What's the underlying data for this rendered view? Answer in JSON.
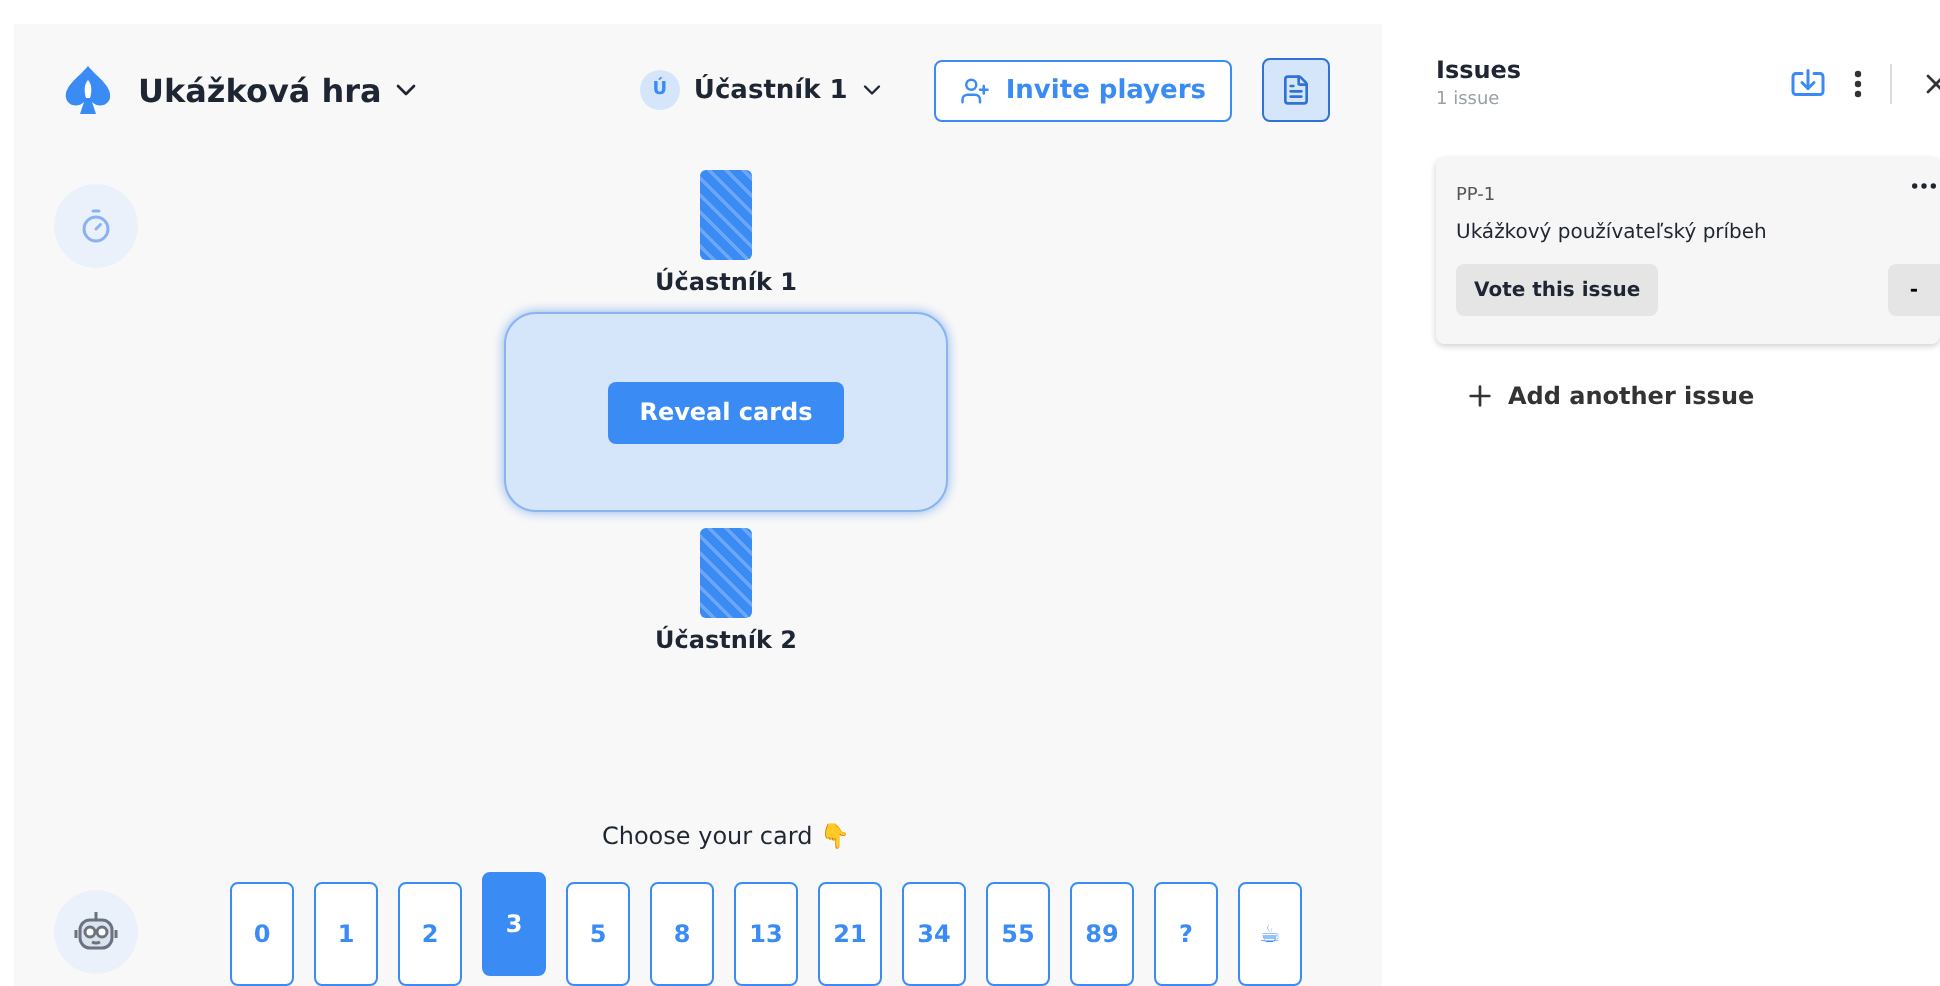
{
  "game": {
    "title": "Ukážková hra",
    "user": {
      "initial": "Ú",
      "name": "Účastník 1"
    },
    "invite_button": "Invite players"
  },
  "table": {
    "top_players": [
      {
        "name": "Účastník 1"
      }
    ],
    "reveal_button": "Reveal cards",
    "bottom_players": [
      {
        "name": "Účastník 2"
      }
    ]
  },
  "deck": {
    "prompt": "Choose your card 👇",
    "cards": [
      {
        "label": "0",
        "selected": false
      },
      {
        "label": "1",
        "selected": false
      },
      {
        "label": "2",
        "selected": false
      },
      {
        "label": "3",
        "selected": true
      },
      {
        "label": "5",
        "selected": false
      },
      {
        "label": "8",
        "selected": false
      },
      {
        "label": "13",
        "selected": false
      },
      {
        "label": "21",
        "selected": false
      },
      {
        "label": "34",
        "selected": false
      },
      {
        "label": "55",
        "selected": false
      },
      {
        "label": "89",
        "selected": false
      },
      {
        "label": "?",
        "selected": false
      },
      {
        "label": "☕",
        "selected": false
      }
    ]
  },
  "issues_panel": {
    "title": "Issues",
    "count": "1 issue",
    "issues": [
      {
        "key": "PP-1",
        "title": "Ukážkový používateľský príbeh",
        "vote_button": "Vote this issue",
        "points": "-"
      }
    ],
    "add_button": "Add another issue"
  }
}
